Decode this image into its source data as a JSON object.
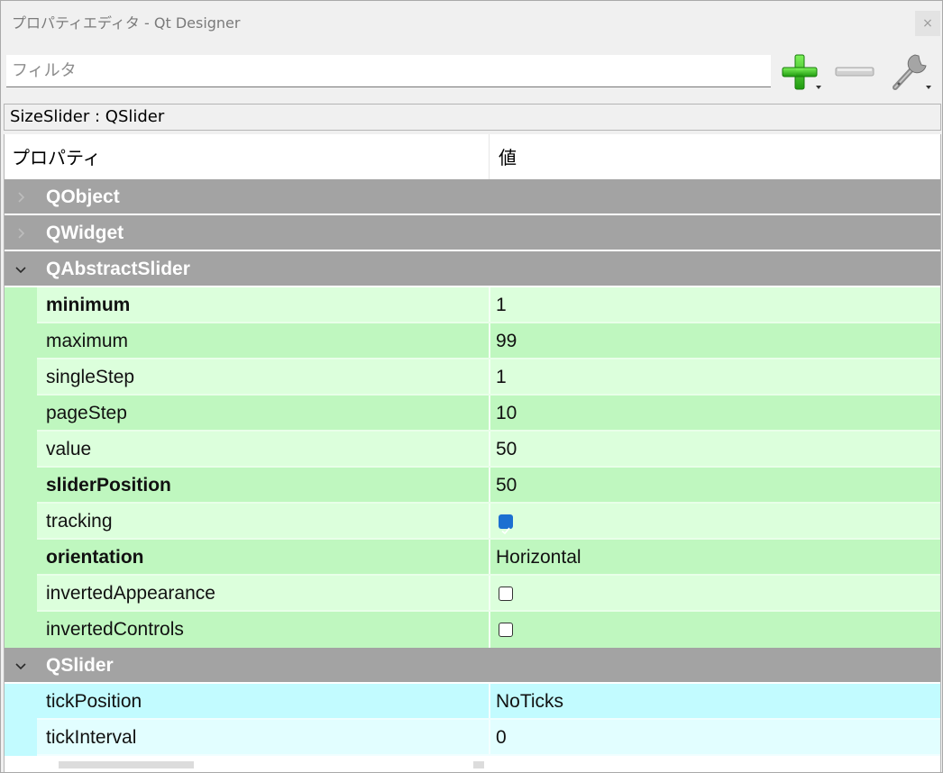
{
  "window": {
    "title": "プロパティエディタ - Qt Designer",
    "close_glyph": "×"
  },
  "toolbar": {
    "filter_placeholder": "フィルタ",
    "add_icon": "plus-icon",
    "remove_icon": "minus-icon",
    "configure_icon": "wrench-icon"
  },
  "object": {
    "label": "SizeSlider : QSlider"
  },
  "tree": {
    "header_property": "プロパティ",
    "header_value": "値",
    "groups": [
      {
        "name": "QObject",
        "expanded": false
      },
      {
        "name": "QWidget",
        "expanded": false
      },
      {
        "name": "QAbstractSlider",
        "expanded": true,
        "properties": [
          {
            "name": "minimum",
            "value": "1"
          },
          {
            "name": "maximum",
            "value": "99"
          },
          {
            "name": "singleStep",
            "value": "1"
          },
          {
            "name": "pageStep",
            "value": "10"
          },
          {
            "name": "value",
            "value": "50"
          },
          {
            "name": "sliderPosition",
            "value": "50"
          },
          {
            "name": "tracking",
            "checked": true
          },
          {
            "name": "orientation",
            "value": "Horizontal"
          },
          {
            "name": "invertedAppearance",
            "checked": false
          },
          {
            "name": "invertedControls",
            "checked": false
          }
        ]
      },
      {
        "name": "QSlider",
        "expanded": true,
        "properties": [
          {
            "name": "tickPosition",
            "value": "NoTicks"
          },
          {
            "name": "tickInterval",
            "value": "0"
          }
        ]
      }
    ]
  },
  "colors": {
    "group_bg": "#a3a3a3",
    "green_dark": "#bff7bf",
    "green_light": "#dcffdc",
    "cyan_dark": "#c2fbff",
    "cyan_light": "#e2feff",
    "checkbox_on": "#1c6fd1"
  }
}
